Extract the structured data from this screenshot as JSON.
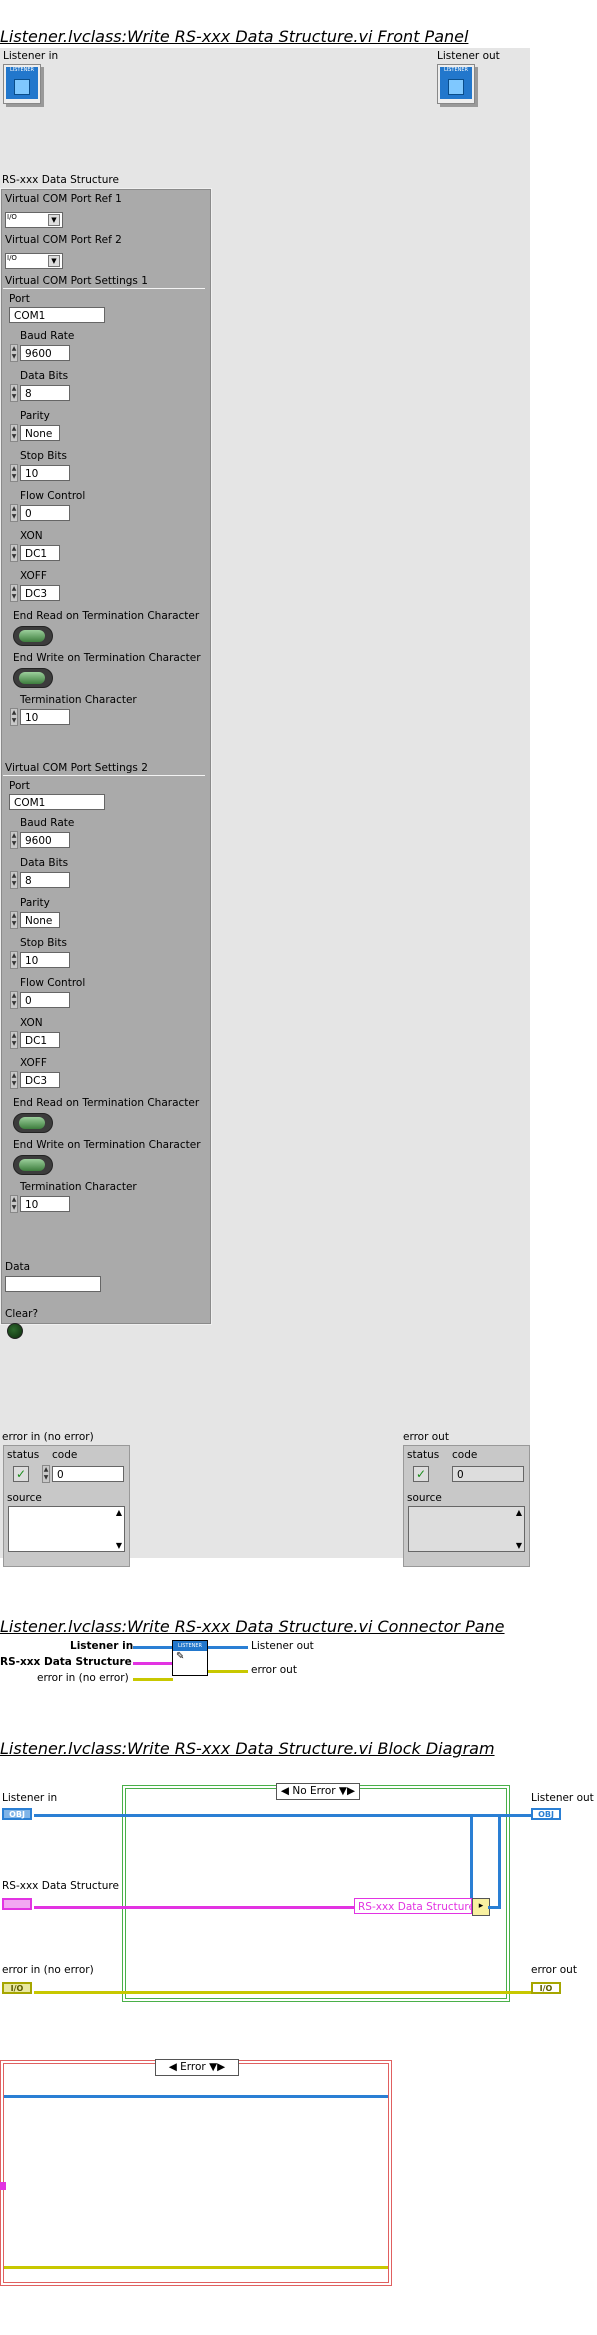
{
  "front_panel": {
    "title": "Listener.lvclass:Write RS-xxx Data Structure.vi Front Panel",
    "listener_in_label": "Listener in",
    "listener_out_label": "Listener out",
    "listener_icon_text": "LISTENER",
    "cluster_label": "RS-xxx Data Structure",
    "vcom_ref1_label": "Virtual COM Port Ref 1",
    "vcom_ref2_label": "Virtual COM Port Ref 2",
    "settings1_label": "Virtual COM Port Settings 1",
    "settings2_label": "Virtual COM Port Settings 2",
    "settings": {
      "port_label": "Port",
      "port_value": "COM1",
      "baud_label": "Baud Rate",
      "baud_value": "9600",
      "databits_label": "Data Bits",
      "databits_value": "8",
      "parity_label": "Parity",
      "parity_value": "None",
      "stopbits_label": "Stop Bits",
      "stopbits_value": "10",
      "flow_label": "Flow Control",
      "flow_value": "0",
      "xon_label": "XON",
      "xon_value": "DC1",
      "xoff_label": "XOFF",
      "xoff_value": "DC3",
      "end_read_label": "End Read on Termination Character",
      "end_write_label": "End Write on Termination Character",
      "term_char_label": "Termination Character",
      "term_char_value": "10"
    },
    "data_label": "Data",
    "data_value": "",
    "clear_label": "Clear?",
    "error_in_label": "error in (no error)",
    "error_out_label": "error out",
    "status_label": "status",
    "code_label": "code",
    "source_label": "source",
    "error_in_code": "0",
    "error_out_code": "0"
  },
  "connector_pane": {
    "title": "Listener.lvclass:Write RS-xxx Data Structure.vi Connector Pane",
    "in1": "Listener in",
    "in2": "RS-xxx Data Structure",
    "in3": "error in (no error)",
    "out1": "Listener out",
    "out2": "error out",
    "icon_text": "LISTENER"
  },
  "block_diagram": {
    "title": "Listener.lvclass:Write RS-xxx Data Structure.vi Block Diagram",
    "listener_in": "Listener in",
    "listener_out": "Listener out",
    "rs_in": "RS-xxx Data Structure",
    "error_in": "error in (no error)",
    "error_out": "error out",
    "case_no_error": "No Error",
    "case_error": "Error",
    "unbundle_label": "RS-xxx Data Structure",
    "obj_term": "OBJ",
    "err_term": "I/O"
  },
  "colors": {
    "class_wire": "#2a7fd4",
    "cluster_wire": "#e233e2",
    "error_wire": "#c8c800",
    "case_green": "#49b049",
    "case_red": "#e06060"
  }
}
